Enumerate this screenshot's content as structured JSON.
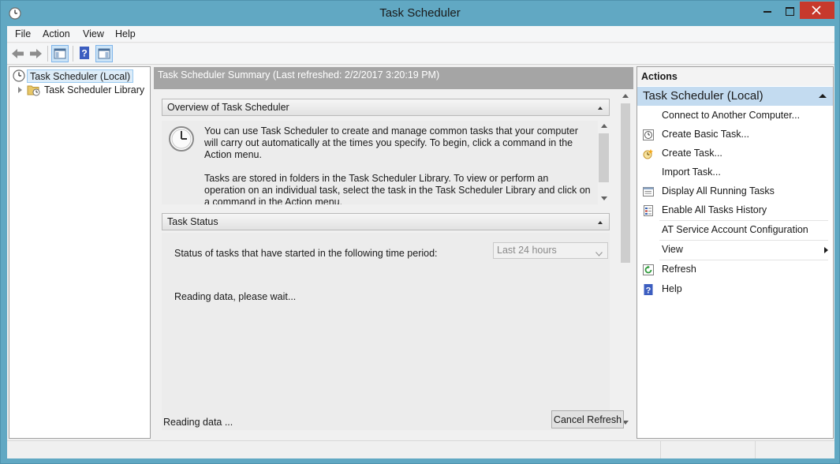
{
  "window": {
    "title": "Task Scheduler",
    "controls": [
      "minimize-icon",
      "maximize-icon",
      "close-icon"
    ],
    "accent_color": "#61a8c3",
    "close_color": "#c7392c"
  },
  "menu": {
    "items": [
      "File",
      "Action",
      "View",
      "Help"
    ]
  },
  "toolbar": {
    "buttons": [
      "back-arrow-icon",
      "forward-arrow-icon",
      "show-hide-console-tree-icon",
      "help-icon",
      "show-hide-action-pane-icon"
    ]
  },
  "tree": {
    "root": "Task Scheduler (Local)",
    "child": "Task Scheduler Library"
  },
  "summary": {
    "header": "Task Scheduler Summary (Last refreshed: 2/2/2017 3:20:19 PM)",
    "overview": {
      "title": "Overview of Task Scheduler",
      "paragraphs": [
        "You can use Task Scheduler to create and manage common tasks that your computer will carry out automatically at the times you specify. To begin, click a command in the Action menu.",
        "Tasks are stored in folders in the Task Scheduler Library. To view or perform an operation on an individual task, select the task in the Task Scheduler Library and click on a command in the Action menu."
      ]
    },
    "task_status": {
      "title": "Task Status",
      "period_label": "Status of tasks that have started in the following time period:",
      "period_value": "Last 24 hours",
      "reading": "Reading data, please wait..."
    },
    "footer": {
      "reading": "Reading data ...",
      "cancel_button": "Cancel Refresh"
    }
  },
  "actions": {
    "title": "Actions",
    "group": "Task Scheduler (Local)",
    "items": [
      {
        "label": "Connect to Another Computer...",
        "icon": ""
      },
      {
        "label": "Create Basic Task...",
        "icon": "create-basic-task-icon"
      },
      {
        "label": "Create Task...",
        "icon": "create-task-icon"
      },
      {
        "label": "Import Task...",
        "icon": ""
      },
      {
        "label": "Display All Running Tasks",
        "icon": "running-tasks-icon"
      },
      {
        "label": "Enable All Tasks History",
        "icon": "tasks-history-icon"
      },
      {
        "label": "AT Service Account Configuration",
        "icon": ""
      },
      {
        "label": "View",
        "icon": ""
      },
      {
        "label": "Refresh",
        "icon": "refresh-icon"
      },
      {
        "label": "Help",
        "icon": "help-icon"
      }
    ]
  }
}
